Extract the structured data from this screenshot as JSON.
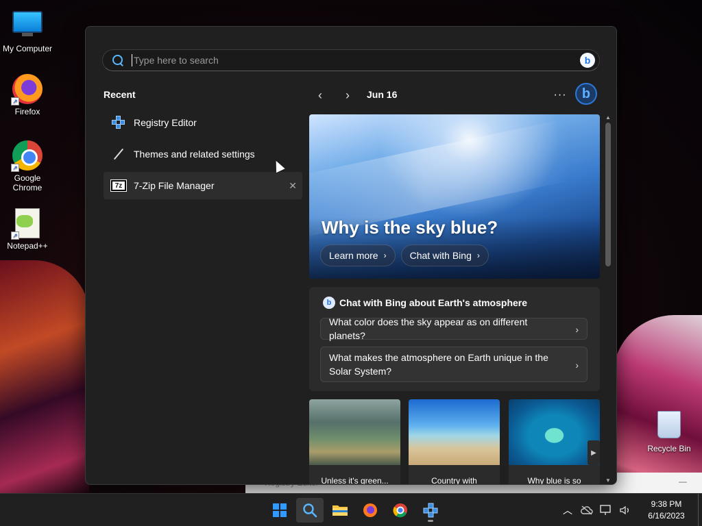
{
  "desktop": {
    "icons": [
      {
        "label": "My Computer"
      },
      {
        "label": "Firefox"
      },
      {
        "label": "Google Chrome"
      },
      {
        "label": "Notepad++"
      },
      {
        "label": "Recycle Bin"
      }
    ]
  },
  "search": {
    "placeholder": "Type here to search",
    "value": ""
  },
  "recent": {
    "title": "Recent",
    "items": [
      {
        "label": "Registry Editor",
        "icon": "registry-icon"
      },
      {
        "label": "Themes and related settings",
        "icon": "paintbrush-icon"
      },
      {
        "label": "7-Zip File Manager",
        "icon": "7zip-icon",
        "close_glyph": "✕",
        "icon_text": "7z"
      }
    ]
  },
  "highlights": {
    "date": "Jun 16",
    "more_glyph": "···",
    "hero": {
      "title": "Why is the sky blue?",
      "buttons": [
        {
          "label": "Learn more"
        },
        {
          "label": "Chat with Bing"
        }
      ]
    },
    "chat": {
      "title": "Chat with Bing about Earth's atmosphere",
      "questions": [
        {
          "label": "What color does the sky appear as on different planets?"
        },
        {
          "label": "What makes the atmosphere on Earth unique in the Solar System?"
        }
      ]
    },
    "thumbnails": [
      {
        "caption": "Unless it's green..."
      },
      {
        "caption": "Country with"
      },
      {
        "caption": "Why blue is so"
      }
    ]
  },
  "background_window": {
    "title": "Registry Editor",
    "minimize_glyph": "—"
  },
  "taskbar": {
    "clock_time": "9:38 PM",
    "clock_date": "6/16/2023"
  },
  "colors": {
    "accent": "#2f9bff",
    "panel": "#202020",
    "card": "#2b2b2b"
  }
}
